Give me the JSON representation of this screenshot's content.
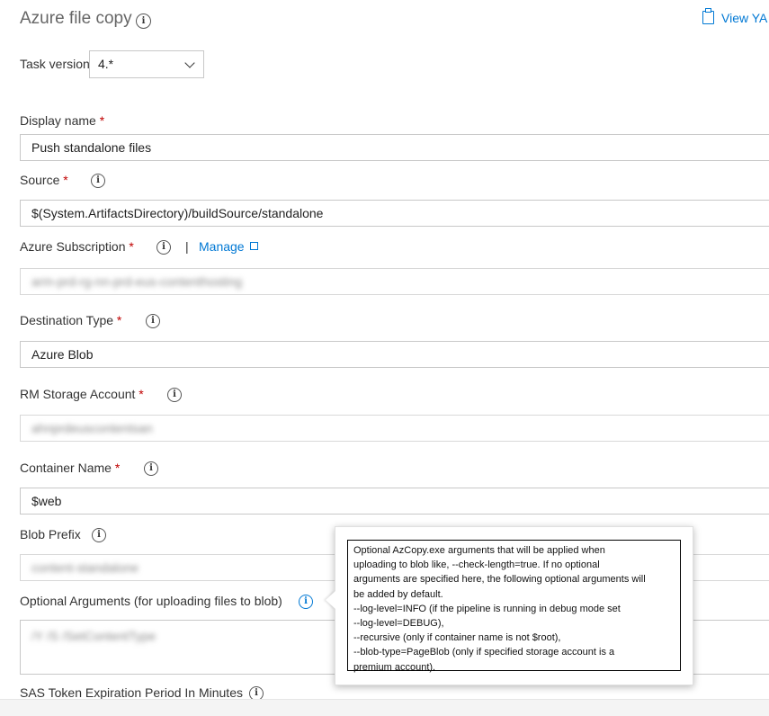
{
  "header": {
    "title": "Azure file copy",
    "view_yaml": "View YA"
  },
  "task_version": {
    "label": "Task version",
    "value": "4.*"
  },
  "required_mark": "*",
  "fields": {
    "display_name": {
      "label": "Display name",
      "value": "Push standalone files"
    },
    "source": {
      "label": "Source",
      "value": "$(System.ArtifactsDirectory)/buildSource/standalone"
    },
    "azure_subscription": {
      "label": "Azure Subscription",
      "separator": "|",
      "manage": "Manage",
      "value": "arm-prd-rg-nn-prd-eus-contenthosting"
    },
    "destination_type": {
      "label": "Destination Type",
      "value": "Azure Blob"
    },
    "rm_storage_account": {
      "label": "RM Storage Account",
      "value": "ahnprdeuscontentsan"
    },
    "container_name": {
      "label": "Container Name",
      "value": "$web"
    },
    "blob_prefix": {
      "label": "Blob Prefix",
      "value": "content-standalone"
    },
    "optional_arguments": {
      "label": "Optional Arguments (for uploading files to blob)",
      "value": "/Y /S /SetContentType"
    },
    "sas_token": {
      "label": "SAS Token Expiration Period In Minutes"
    }
  },
  "tooltip": {
    "lines": [
      "Optional AzCopy.exe arguments that will be applied when",
      "uploading to blob like, --check-length=true. If no optional",
      "arguments are specified here, the following optional arguments will",
      "be added by default.",
      "--log-level=INFO (if the pipeline is running in debug mode set",
      "--log-level=DEBUG),",
      "--recursive (only if container name is not $root),",
      "--blob-type=PageBlob (only if specified storage account is a",
      "premium account)."
    ]
  },
  "colors": {
    "accent": "#0078d4",
    "required": "#c00000"
  },
  "icons": [
    "info-icon",
    "clipboard-icon",
    "chevron-down-icon",
    "external-link-icon"
  ]
}
